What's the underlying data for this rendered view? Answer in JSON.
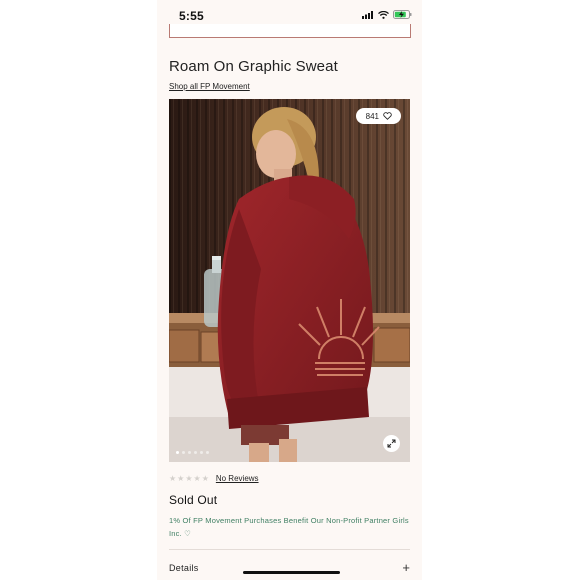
{
  "status_bar": {
    "time": "5:55",
    "icons": [
      "cellular-signal-icon",
      "wifi-icon",
      "battery-charging-icon"
    ]
  },
  "product": {
    "title": "Roam On Graphic Sweat",
    "shop_link": "Shop all FP Movement",
    "like_count": "841",
    "image_count": 6,
    "active_image_index": 0,
    "rating": {
      "stars_filled": 0,
      "stars_total": 5,
      "reviews_label": "No Reviews"
    },
    "availability": "Sold Out",
    "benefit_text": "1% Of FP Movement Purchases Benefit Our Non-Profit Partner Girls Inc. ♡",
    "details_label": "Details",
    "details_icon": "plus-icon"
  },
  "colors": {
    "page_background": "#fdf8f5",
    "benefit_text": "#3f7f63",
    "star_empty": "#d4d0cc",
    "sweatshirt": "#8b2226"
  }
}
